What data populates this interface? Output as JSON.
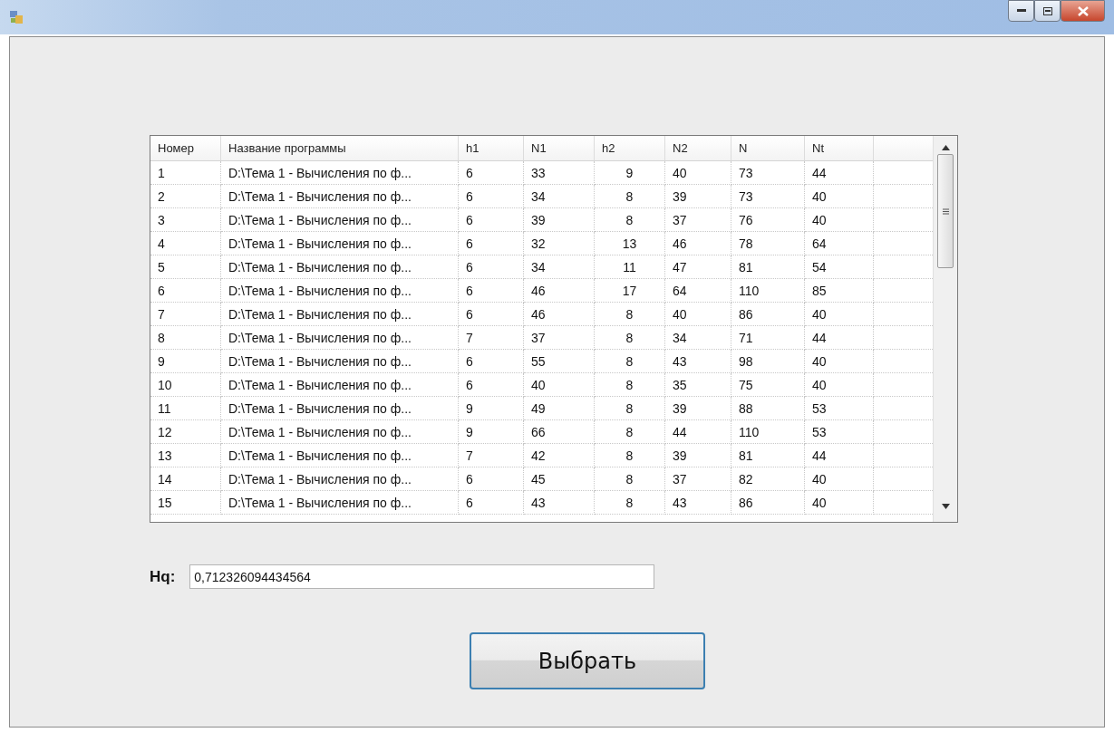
{
  "table": {
    "columns": [
      "Номер",
      "Название программы",
      "h1",
      "N1",
      "h2",
      "N2",
      "N",
      "Nt"
    ],
    "rows": [
      [
        "1",
        "D:\\Тема 1 - Вычисления по ф...",
        "6",
        "33",
        "9",
        "40",
        "73",
        "44"
      ],
      [
        "2",
        "D:\\Тема 1 - Вычисления по ф...",
        "6",
        "34",
        "8",
        "39",
        "73",
        "40"
      ],
      [
        "3",
        "D:\\Тема 1 - Вычисления по ф...",
        "6",
        "39",
        "8",
        "37",
        "76",
        "40"
      ],
      [
        "4",
        "D:\\Тема 1 - Вычисления по ф...",
        "6",
        "32",
        "13",
        "46",
        "78",
        "64"
      ],
      [
        "5",
        "D:\\Тема 1 - Вычисления по ф...",
        "6",
        "34",
        "11",
        "47",
        "81",
        "54"
      ],
      [
        "6",
        "D:\\Тема 1 - Вычисления по ф...",
        "6",
        "46",
        "17",
        "64",
        "110",
        "85"
      ],
      [
        "7",
        "D:\\Тема 1 - Вычисления по ф...",
        "6",
        "46",
        "8",
        "40",
        "86",
        "40"
      ],
      [
        "8",
        "D:\\Тема 1 - Вычисления по ф...",
        "7",
        "37",
        "8",
        "34",
        "71",
        "44"
      ],
      [
        "9",
        "D:\\Тема 1 - Вычисления по ф...",
        "6",
        "55",
        "8",
        "43",
        "98",
        "40"
      ],
      [
        "10",
        "D:\\Тема 1 - Вычисления по ф...",
        "6",
        "40",
        "8",
        "35",
        "75",
        "40"
      ],
      [
        "11",
        "D:\\Тема 1 - Вычисления по ф...",
        "9",
        "49",
        "8",
        "39",
        "88",
        "53"
      ],
      [
        "12",
        "D:\\Тема 1 - Вычисления по ф...",
        "9",
        "66",
        "8",
        "44",
        "110",
        "53"
      ],
      [
        "13",
        "D:\\Тема 1 - Вычисления по ф...",
        "7",
        "42",
        "8",
        "39",
        "81",
        "44"
      ],
      [
        "14",
        "D:\\Тема 1 - Вычисления по ф...",
        "6",
        "45",
        "8",
        "37",
        "82",
        "40"
      ],
      [
        "15",
        "D:\\Тема 1 - Вычисления по ф...",
        "6",
        "43",
        "8",
        "43",
        "86",
        "40"
      ]
    ]
  },
  "hq": {
    "label": "Hq:",
    "value": "0,712326094434564"
  },
  "button": {
    "label": "Выбрать"
  }
}
